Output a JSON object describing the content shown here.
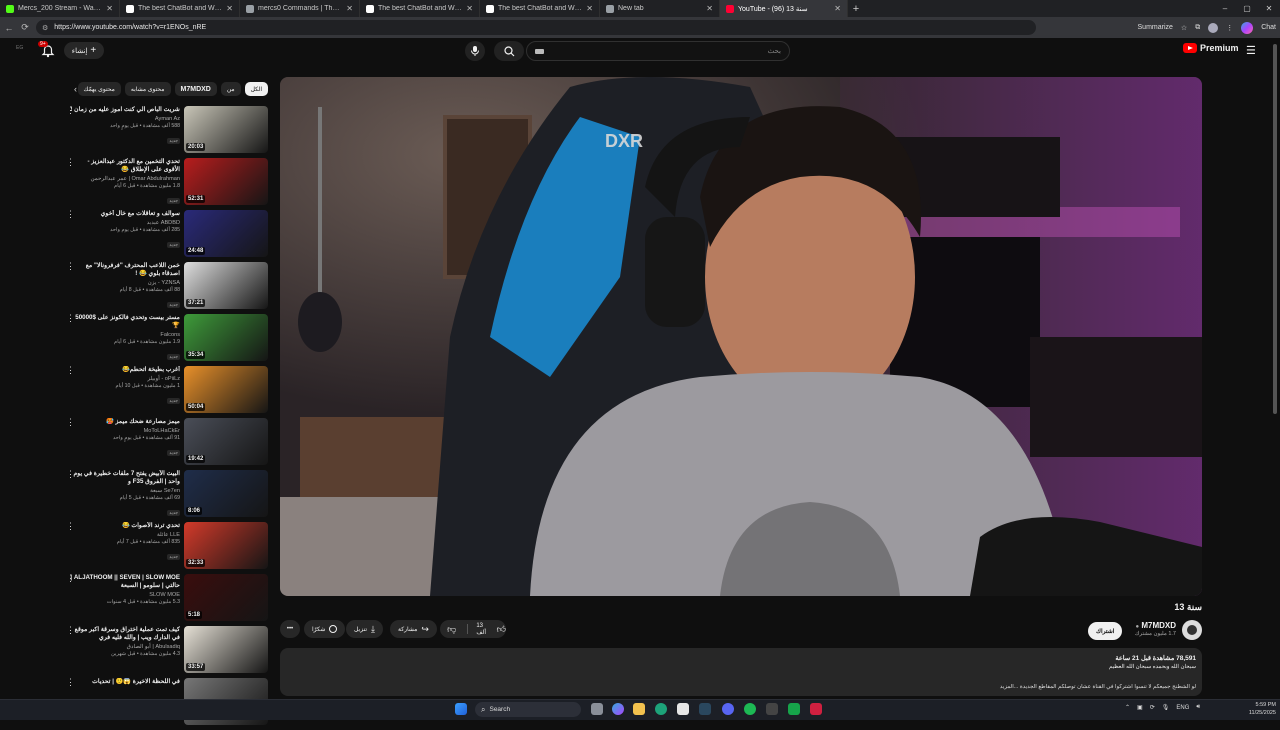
{
  "browser": {
    "tabs": [
      {
        "title": "Mercs_200 Stream - Watch Live o",
        "fav_color": "#53fc18",
        "active": false
      },
      {
        "title": "The best ChatBot and Widgets fo",
        "fav_color": "#ffffff",
        "active": false
      },
      {
        "title": "mercs0 Commands | The best Ch",
        "fav_color": "#9aa0a6",
        "active": false
      },
      {
        "title": "The best ChatBot and Widgets fo",
        "fav_color": "#ffffff",
        "active": false
      },
      {
        "title": "The best ChatBot and Widgets fo",
        "fav_color": "#ffffff",
        "active": false
      },
      {
        "title": "New tab",
        "fav_color": "#9aa0a6",
        "active": false
      },
      {
        "title": "YouTube - (96) 13 سنة",
        "fav_color": "#ff0033",
        "active": true
      }
    ],
    "new_tab_glyph": "+",
    "url": "https://www.youtube.com/watch?v=r1ENOs_nRE",
    "summarize_label": "Summarize",
    "window_controls": [
      "–",
      "▢",
      "✕"
    ]
  },
  "youtube": {
    "search_placeholder": "بحث",
    "create_label": "إنشاء",
    "notification_count": "9+",
    "logo_text": "Premium",
    "region_code": "EG",
    "chips": [
      {
        "label": "الكل",
        "selected": true,
        "bold": false
      },
      {
        "label": "من",
        "selected": false,
        "bold": false
      },
      {
        "label": "M7MDXD",
        "selected": false,
        "bold": true
      },
      {
        "label": "محتوى مشابه",
        "selected": false,
        "bold": false
      },
      {
        "label": "محتوى يهمّك",
        "selected": false,
        "bold": false
      }
    ],
    "recommendations": [
      {
        "title": "شريت الباص الي كنت اموز عليه من زمان !",
        "channel": "Ayman Az",
        "stats": "588 ألف مشاهدة • قبل يومٍ واحد",
        "duration": "20:03",
        "thumb_color": "#c9c6b8",
        "badge": "جديد"
      },
      {
        "title": "تحدي التخمين مع الدكتور عبدالعزيز - الأقوى على الإطلاق 😂",
        "channel": "Omar Abdulrahman | عمر عبدالرحمن",
        "stats": "1.8 مليون مشاهدة • قبل 6 أيام",
        "duration": "52:31",
        "thumb_color": "#b81d1d",
        "badge": "جديد"
      },
      {
        "title": "سوالف و تعاقلات مع خال أخوي",
        "channel": "ABDBD عبدبد",
        "stats": "285 ألف مشاهدة • قبل يوم واحد",
        "duration": "24:48",
        "thumb_color": "#2a2a7a",
        "badge": "جديد"
      },
      {
        "title": "خمن اللاعب المحترف \"فرفرونالا\" مع اصدقاء بلوي 😂 !",
        "channel": "YZNSA - يزن",
        "stats": "88 ألف مشاهدة • قبل 8 أيام",
        "duration": "37:21",
        "thumb_color": "#dedede",
        "badge": "جديد"
      },
      {
        "title": "مستر بيست وتحدي فالكونز على $50000 🏆",
        "channel": "Falcons",
        "stats": "1.9 مليون مشاهدة • قبل 6 أيام",
        "duration": "35:34",
        "thumb_color": "#3e9b3a",
        "badge": "جديد"
      },
      {
        "title": "أغرب بطيخة اتحطم😂",
        "channel": "oPiiLz - أوبيلز",
        "stats": "1 مليون مشاهدة • قبل 10 أيام",
        "duration": "50:04",
        "thumb_color": "#e8902a",
        "badge": "جديد"
      },
      {
        "title": "ميمز مصارعة ضحك ميمز 🥵",
        "channel": "MoToLHaCkEr",
        "stats": "91 ألف مشاهدة • قبل يومٍ واحد",
        "duration": "19:42",
        "thumb_color": "#4a4e58",
        "badge": "جديد"
      },
      {
        "title": "البيت الأبيض يفتح 7 ملفات خطيرة في يوم واحد | الفروق F35 و",
        "channel": "Se7en سبعة",
        "stats": "69 ألف مشاهدة • قبل 5 أيام",
        "duration": "8:06",
        "thumb_color": "#1f2d4a",
        "badge": "جديد"
      },
      {
        "title": "تحدي ترند الأصوات 😂",
        "channel": "LLE عائلة",
        "stats": "835 ألف مشاهدة • قبل 7 أيام",
        "duration": "32:33",
        "thumb_color": "#d33a2a",
        "badge": "جديد"
      },
      {
        "title": "ALJATHOOM || SEVEN | SLOW MOE | حالتي | سلومو | السبعة",
        "channel": "SLOW MOE",
        "stats": "5.3 مليون مشاهدة • قبل 4 سنوات",
        "duration": "5:18",
        "thumb_color": "#3a0d0d",
        "badge": ""
      },
      {
        "title": "كيف تمت عملية اختراق وسرقة اكبر موقع في الدارك ويب | والله فليه فري",
        "channel": "Abulsadiq | أبو الصادق",
        "stats": "4.3 مليون مشاهدة • قبل شهرين",
        "duration": "33:57",
        "thumb_color": "#e6e1d6",
        "badge": ""
      },
      {
        "title": "في اللحظة الاخيرة 😱🙂 | تحديات",
        "channel": "",
        "stats": "",
        "duration": "",
        "thumb_color": "#777777",
        "badge": ""
      }
    ],
    "video": {
      "title": "13 سنة",
      "channel_name": "M7MDXD",
      "subscribers": "1.7 مليون مشترك",
      "subscribe_label": "اشتراك",
      "likes": "13 ألف",
      "share_label": "مشاركة",
      "download_label": "تنزيل",
      "thanks_label": "شكرًا",
      "more_glyph": "•••",
      "views_line": "78,591 مشاهدة  قبل 21 ساعة",
      "description_line1": "سبحان الله وبحمده سبحان الله العظيم",
      "description_line2": "لو الشطنج جميعكم لا تنسوا اشتركوا في القناة عشان توصلكم المقاطع الجديدة ...المزيد",
      "player_bg": "#2a2326"
    }
  },
  "taskbar": {
    "search_label": "Search",
    "language": "ENG",
    "time": "5:59 PM",
    "date": "11/25/2025"
  }
}
